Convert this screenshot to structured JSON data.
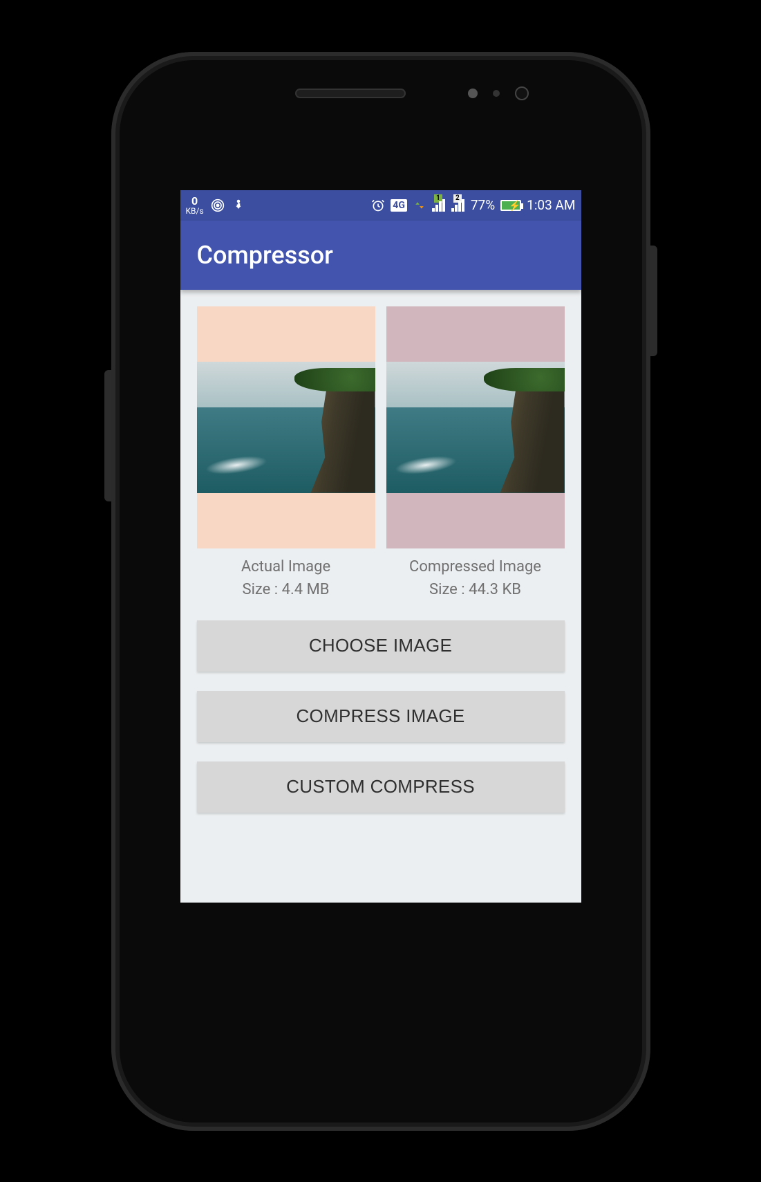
{
  "statusbar": {
    "speed_value": "0",
    "speed_unit": "KB/s",
    "battery_percent": "77%",
    "time": "1:03 AM",
    "fourg": "4G",
    "sim1": "1",
    "sim2": "2"
  },
  "appbar": {
    "title": "Compressor"
  },
  "panels": {
    "actual": {
      "title": "Actual Image",
      "size": "Size : 4.4 MB"
    },
    "compressed": {
      "title": "Compressed Image",
      "size": "Size : 44.3 KB"
    }
  },
  "buttons": {
    "choose": "CHOOSE IMAGE",
    "compress": "COMPRESS IMAGE",
    "custom": "CUSTOM COMPRESS"
  }
}
